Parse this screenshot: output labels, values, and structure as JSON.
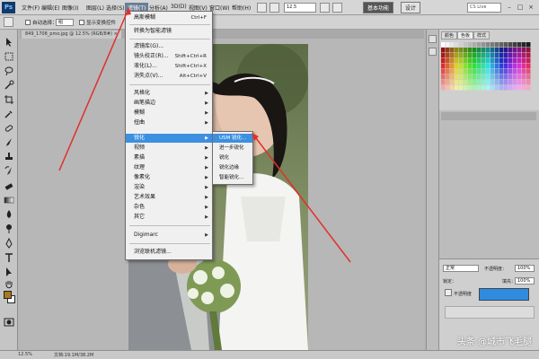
{
  "app": {
    "logo": "Ps",
    "menus": [
      "文件(F)",
      "编辑(E)",
      "图像(I)",
      "图层(L)",
      "选择(S)",
      "滤镜(T)",
      "分析(A)",
      "3D(D)",
      "视图(V)",
      "窗口(W)",
      "帮助(H)"
    ],
    "active_menu": "滤镜(T)",
    "zoom": "12.5",
    "workspace_primary": "基本功能",
    "workspace_secondary": "设计",
    "search_placeholder": "CS Live"
  },
  "options_bar": {
    "auto_select": "自动选择：",
    "auto_select_value": "组",
    "show_transform": "显示变换控件"
  },
  "document": {
    "tab": "849_1708_pmo.jpg @ 12.5% (RGB/8#) ×"
  },
  "filter_menu": {
    "items": [
      {
        "label": "高斯模糊",
        "shortcut": "Ctrl+F"
      },
      {
        "label": "转换为智能滤镜",
        "shortcut": ""
      },
      {
        "label": "滤镜库(G)...",
        "shortcut": ""
      },
      {
        "label": "镜头校正(R)...",
        "shortcut": "Shift+Ctrl+R"
      },
      {
        "label": "液化(L)...",
        "shortcut": "Shift+Ctrl+X"
      },
      {
        "label": "消失点(V)...",
        "shortcut": "Alt+Ctrl+V"
      },
      {
        "label": "风格化",
        "shortcut": ""
      },
      {
        "label": "画笔描边",
        "shortcut": ""
      },
      {
        "label": "模糊",
        "shortcut": ""
      },
      {
        "label": "扭曲",
        "shortcut": ""
      },
      {
        "label": "锐化",
        "shortcut": ""
      },
      {
        "label": "视频",
        "shortcut": ""
      },
      {
        "label": "素描",
        "shortcut": ""
      },
      {
        "label": "纹理",
        "shortcut": ""
      },
      {
        "label": "像素化",
        "shortcut": ""
      },
      {
        "label": "渲染",
        "shortcut": ""
      },
      {
        "label": "艺术效果",
        "shortcut": ""
      },
      {
        "label": "杂色",
        "shortcut": ""
      },
      {
        "label": "其它",
        "shortcut": ""
      },
      {
        "label": "Digimarc",
        "shortcut": ""
      },
      {
        "label": "浏览联机滤镜...",
        "shortcut": ""
      }
    ],
    "highlighted": "锐化"
  },
  "sharpen_submenu": {
    "items": [
      "USM 锐化...",
      "进一步锐化",
      "锐化",
      "锐化边缘",
      "智能锐化..."
    ],
    "highlighted": "USM 锐化..."
  },
  "panels": {
    "swatch_tabs": [
      "颜色",
      "色板",
      "样式"
    ],
    "blend_mode": "正常",
    "opacity_label": "不透明度：",
    "opacity_value": "100%",
    "lock_label": "锁定：",
    "fill_label": "填充：",
    "fill_value": "100%",
    "layer_opacity_label": "不透明度"
  },
  "status": {
    "zoom": "12.5%",
    "doc_size": "文档:19.1M/38.2M"
  },
  "watermark": "头条 @城市飞毛腿",
  "colors": {
    "highlight": "#3d8fe0",
    "annotation": "#e0302a",
    "foreground": "#a8791e"
  }
}
